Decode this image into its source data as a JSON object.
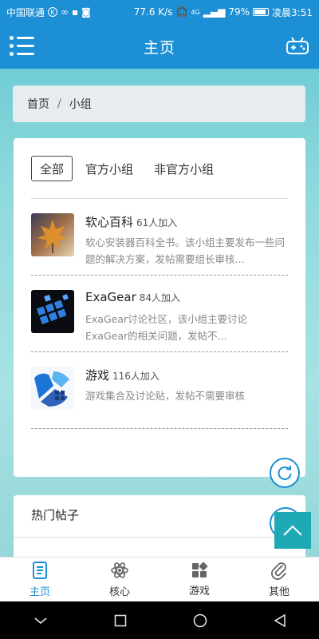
{
  "status_bar": {
    "carrier": "中国联通",
    "speed": "77.6 K/s",
    "signal": "4G",
    "battery": "79%",
    "time": "凌晨3:51"
  },
  "app_bar": {
    "title": "主页",
    "menu_icon": "menu-icon",
    "game_icon": "gamepad-icon"
  },
  "breadcrumb": {
    "home": "首页",
    "separator": "/",
    "current": "小组"
  },
  "tabs": [
    {
      "label": "全部",
      "active": true
    },
    {
      "label": "官方小组",
      "active": false
    },
    {
      "label": "非官方小组",
      "active": false
    }
  ],
  "groups": [
    {
      "name": "软心百科",
      "count": "61人加入",
      "desc": "软心安装器百科全书。该小组主要发布一些问题的解决方案，发帖需要组长审核...",
      "icon": "maple-leaf-thumbnail"
    },
    {
      "name": "ExaGear",
      "count": "84人加入",
      "desc": "ExaGear讨论社区，该小组主要讨论ExaGear的相关问题，发帖不...",
      "icon": "exagear-logo-thumbnail"
    },
    {
      "name": "游戏",
      "count": "116人加入",
      "desc": "游戏集合及讨论贴，发帖不需要审核",
      "icon": "game-logo-thumbnail"
    }
  ],
  "hot_posts": {
    "title": "热门帖子"
  },
  "bottom_nav": [
    {
      "label": "主页",
      "icon": "document-icon",
      "active": true
    },
    {
      "label": "核心",
      "icon": "atom-icon",
      "active": false
    },
    {
      "label": "游戏",
      "icon": "apps-grid-icon",
      "active": false
    },
    {
      "label": "其他",
      "icon": "paperclip-icon",
      "active": false
    }
  ],
  "colors": {
    "primary": "#1d8fd4",
    "scroll_top": "#1fa9b4"
  }
}
